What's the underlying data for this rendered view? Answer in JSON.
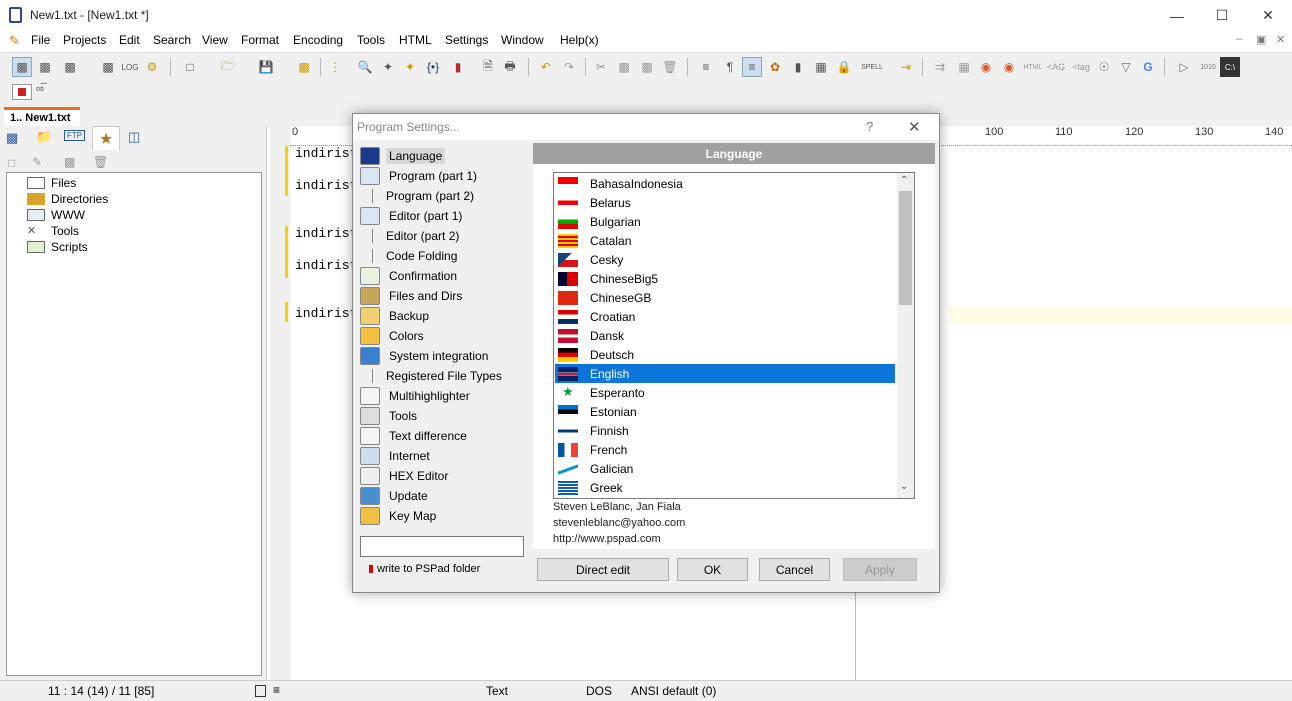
{
  "window": {
    "title": "New1.txt - [New1.txt *]"
  },
  "menu": [
    "File",
    "Projects",
    "Edit",
    "Search",
    "View",
    "Format",
    "Encoding",
    "Tools",
    "HTML",
    "Settings",
    "Window",
    "Help(x)"
  ],
  "tabs": {
    "doc": "1.. New1.txt"
  },
  "left_panel": {
    "tree": [
      "Files",
      "Directories",
      "WWW",
      "Tools",
      "Scripts"
    ]
  },
  "editor": {
    "ruler": [
      "0",
      "100",
      "110",
      "120",
      "130",
      "140"
    ],
    "lines": [
      "indiriste",
      "indiriste",
      "indiriste",
      "indiriste",
      "indiriste"
    ]
  },
  "status": {
    "position": "11 : 14 (14) / 11  [85]",
    "mode": "Text",
    "eol": "DOS",
    "encoding": "ANSI default (0)"
  },
  "dialog": {
    "title": "Program Settings...",
    "help": "?",
    "close": "✕",
    "categories": [
      {
        "label": "Language",
        "selected": true,
        "sub": false
      },
      {
        "label": "Program  (part 1)",
        "sub": false
      },
      {
        "label": "Program  (part 2)",
        "sub": true
      },
      {
        "label": "Editor  (part 1)",
        "sub": false
      },
      {
        "label": "Editor  (part 2)",
        "sub": true
      },
      {
        "label": "Code Folding",
        "sub": true
      },
      {
        "label": "Confirmation",
        "sub": false
      },
      {
        "label": "Files and Dirs",
        "sub": false
      },
      {
        "label": "Backup",
        "sub": false
      },
      {
        "label": "Colors",
        "sub": false
      },
      {
        "label": "System integration",
        "sub": false
      },
      {
        "label": "Registered File Types",
        "sub": true
      },
      {
        "label": "Multihighlighter",
        "sub": false
      },
      {
        "label": "Tools",
        "sub": false
      },
      {
        "label": "Text difference",
        "sub": false
      },
      {
        "label": "Internet",
        "sub": false
      },
      {
        "label": "HEX Editor",
        "sub": false
      },
      {
        "label": "Update",
        "sub": false
      },
      {
        "label": "Key Map",
        "sub": false
      }
    ],
    "write_label": "write to PSPad folder",
    "section_header": "Language",
    "languages": [
      "BahasaIndonesia",
      "Belarus",
      "Bulgarian",
      "Catalan",
      "Cesky",
      "ChineseBig5",
      "ChineseGB",
      "Croatian",
      "Dansk",
      "Deutsch",
      "English",
      "Esperanto",
      "Estonian",
      "Finnish",
      "French",
      "Galician",
      "Greek"
    ],
    "selected_language": "English",
    "credits": [
      "Steven LeBlanc, Jan Fiala",
      "stevenleblanc@yahoo.com",
      "http://www.pspad.com"
    ],
    "buttons": {
      "direct_edit": "Direct edit",
      "ok": "OK",
      "cancel": "Cancel",
      "apply": "Apply"
    }
  },
  "colors": {
    "selection": "#0a74d8",
    "tab_accent": "#e86e1c",
    "modified_bar": "#f5d20a"
  }
}
